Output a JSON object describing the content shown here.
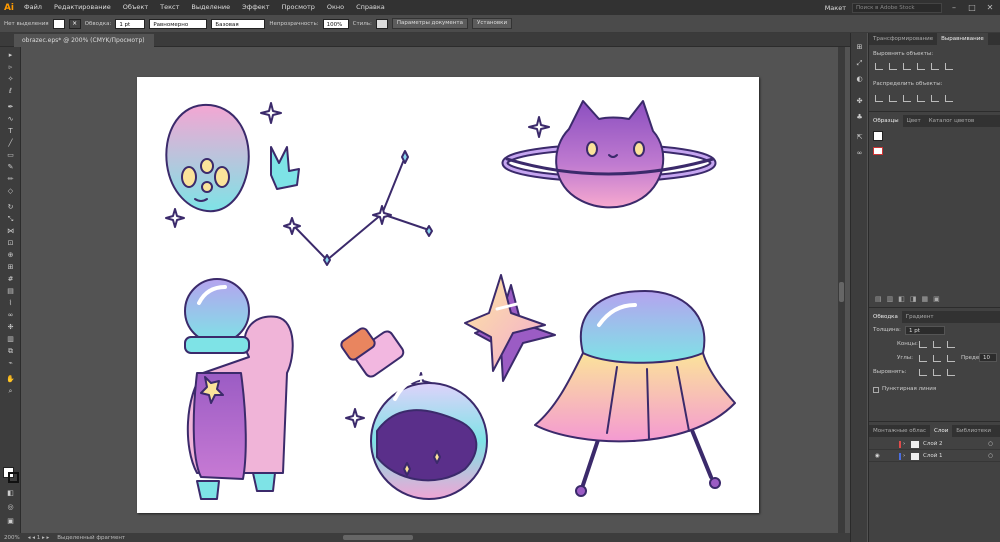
{
  "app": {
    "logo": "Ai",
    "menu": [
      "Файл",
      "Редактирование",
      "Объект",
      "Текст",
      "Выделение",
      "Эффект",
      "Просмотр",
      "Окно",
      "Справка"
    ],
    "workspace": "Макет",
    "search_placeholder": "Поиск в Adobe Stock"
  },
  "control_bar": {
    "selection": "Нет выделения",
    "stroke_label": "Обводка:",
    "stroke_weight": "1 pt",
    "profile": "Равномерно",
    "brush": "Базовая",
    "opacity_label": "Непрозрачность:",
    "opacity": "100%",
    "style_label": "Стиль:",
    "doc_setup": "Параметры документа",
    "prefs": "Установки"
  },
  "document": {
    "tab": "obrazec.eps* @ 200% (CMYK/Просмотр)"
  },
  "status": {
    "zoom": "200%",
    "tool": "Выделенный фрагмент"
  },
  "panels": {
    "top_tabs": [
      "Трансформирование",
      "Выравнивание"
    ],
    "align_objects": "Выровнять объекты:",
    "distribute_objects": "Распределить объекты:",
    "swatches_tabs": [
      "Образцы",
      "Цвет",
      "Каталог цветов"
    ],
    "stroke_tabs": [
      "Обводка",
      "Градиент"
    ],
    "stroke": {
      "weight_label": "Толщина:",
      "weight": "1 pt",
      "cap_label": "Концы:",
      "corner_label": "Углы:",
      "limit_label": "Предел:",
      "limit": "10",
      "align_label": "Выровнять:",
      "dashed": "Пунктирная линия"
    },
    "layers_tabs": [
      "Монтажные облас",
      "Слои",
      "Библиотеки"
    ],
    "layers": [
      "Слой 2",
      "Слой 1"
    ],
    "layer_colors": [
      "#e04b4b",
      "#4b6ee0"
    ]
  },
  "colors": {
    "accent": "#ff9a00",
    "app_bg": "#535353",
    "ink": "#3b2a6b",
    "pink": "#f4a6d3",
    "purple": "#9b5cc4",
    "cyan": "#7ee3e6",
    "yellow": "#fbe39a"
  }
}
